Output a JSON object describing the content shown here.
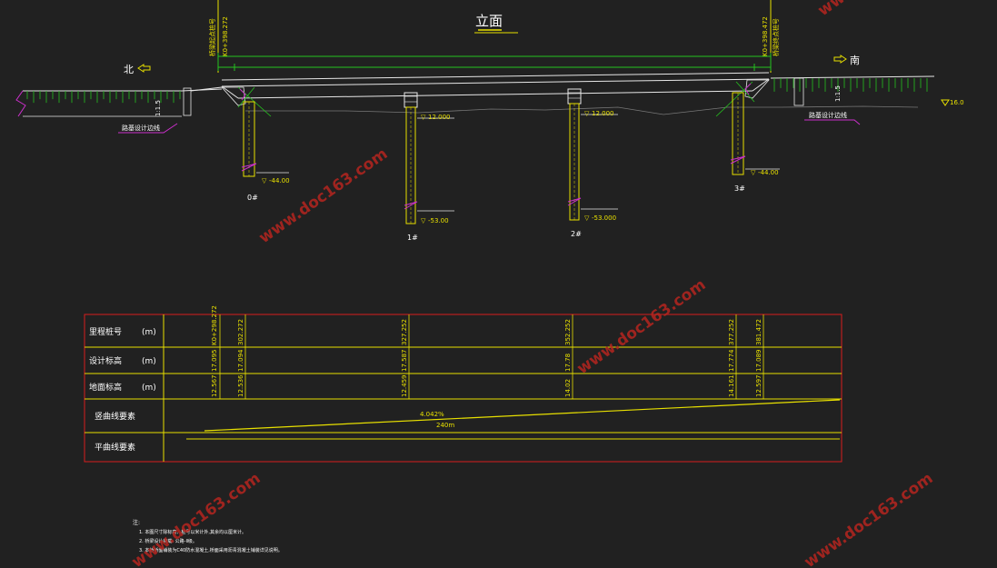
{
  "drawing": {
    "title": "立面",
    "dir_north": "北",
    "dir_south": "南",
    "left_station": "K0+398.272",
    "left_station_label": "桥梁起点桩号",
    "right_station": "K0+398.472",
    "right_station_label": "桥梁终点桩号",
    "slope_left": "1:1.5",
    "slope_right": "1:1.5",
    "left_ground_note": "路基设计边线",
    "right_ground_note": "路基设计边线",
    "water_level": "16.0",
    "piers": [
      {
        "label": "0#",
        "top_elev": "",
        "bottom_elev": "-44.00"
      },
      {
        "label": "1#",
        "top_elev": "12.000",
        "bottom_elev": "-53.00"
      },
      {
        "label": "2#",
        "top_elev": "12.000",
        "bottom_elev": "-53.000"
      },
      {
        "label": "3#",
        "top_elev": "",
        "bottom_elev": "-44.00"
      }
    ]
  },
  "table": {
    "rows": [
      {
        "label": "里程桩号",
        "unit": "(m)"
      },
      {
        "label": "设计标高",
        "unit": "(m)"
      },
      {
        "label": "地面标高",
        "unit": "(m)"
      },
      {
        "label": "竖曲线要素",
        "unit": ""
      },
      {
        "label": "平曲线要素",
        "unit": ""
      }
    ],
    "stations": [
      "K0+298.272",
      "302.272",
      "327.252",
      "352.252",
      "377.252",
      "381.472"
    ],
    "design_elev": [
      "17.095",
      "17.094",
      "17.587",
      "17.78",
      "17.774",
      "17.089"
    ],
    "ground_elev": [
      "12.567",
      "12.536",
      "12.459",
      "14.02",
      "14.161",
      "12.597"
    ],
    "slope": "4.042%",
    "length": "240m"
  },
  "notes": {
    "heading": "注:",
    "lines": [
      "1. 本图尺寸除标高、桩号以米计外,其余均以厘米计。",
      "2. 桥梁设计荷载: 公路-Ⅱ级。",
      "3. 本桥桥面铺装为C40防水混凝土,桥面采用沥青混凝土铺装详见说明。"
    ]
  },
  "watermark": "www.doc163.com",
  "colors": {
    "bg": "#212121",
    "line": "#e6e6e6",
    "yellow": "#e8e000",
    "green": "#25c21e",
    "red": "#d61d1d",
    "magenta": "#cc2fcc"
  }
}
